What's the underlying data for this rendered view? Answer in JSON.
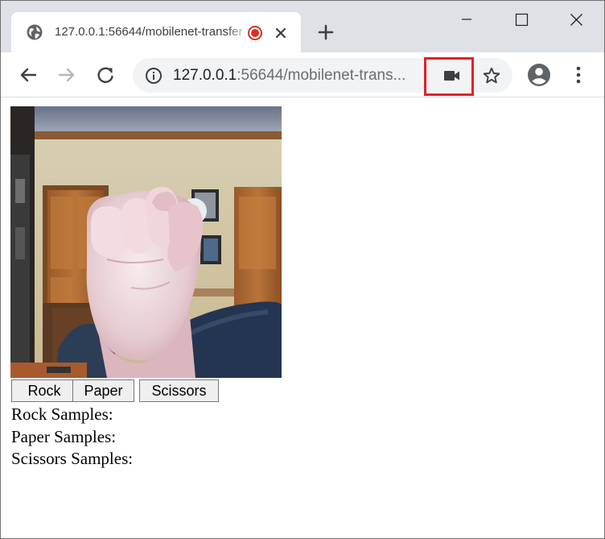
{
  "browser": {
    "tab": {
      "title": "127.0.0.1:56644/mobilenet-transfer",
      "favicon": "globe-icon",
      "recording_indicator": "recording-dot-icon",
      "close": "close-icon"
    },
    "new_tab": "plus-icon",
    "window_controls": [
      "minimize-icon",
      "maximize-icon",
      "close-icon"
    ],
    "toolbar": {
      "back": "back-arrow-icon",
      "forward": "forward-arrow-icon",
      "reload": "reload-icon",
      "site_info": "info-icon",
      "url_host": "127.0.0.1",
      "url_rest": ":56644/mobilenet-trans...",
      "camera_indicator": "video-camera-icon",
      "bookmark": "star-icon",
      "profile": "account-icon",
      "menu": "kebab-menu-icon"
    },
    "colors": {
      "tab_strip": "#dee1e6",
      "omnibox": "#f1f3f4",
      "highlight": "#e02128",
      "recording": "#d93025"
    }
  },
  "page": {
    "webcam": {
      "description_icon": "webcam-video-feed"
    },
    "buttons": {
      "rock": "Rock",
      "paper": "Paper",
      "scissors": "Scissors"
    },
    "samples": {
      "rock": "Rock Samples:",
      "paper": "Paper Samples:",
      "scissors": "Scissors Samples:"
    }
  }
}
